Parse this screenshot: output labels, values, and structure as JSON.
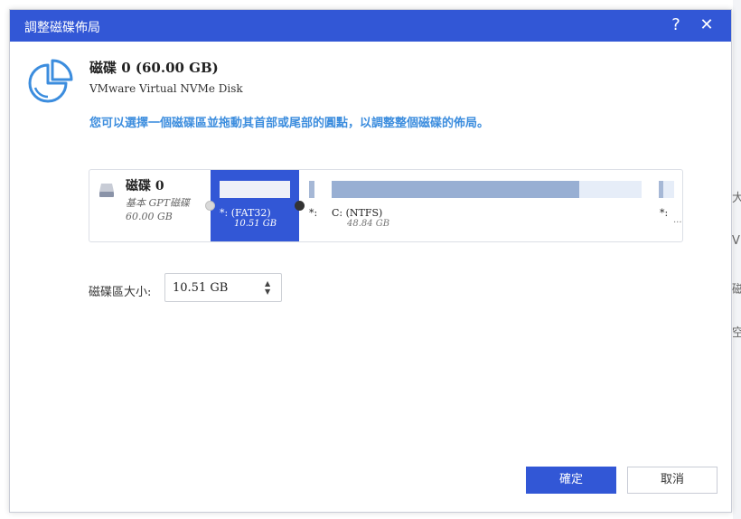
{
  "dialog": {
    "title": "調整磁碟佈局",
    "help_icon": "?",
    "close_icon": "✕"
  },
  "disk": {
    "name": "磁碟 0 (60.00 GB)",
    "model": "VMware Virtual NVMe Disk"
  },
  "instruction": "您可以選擇一個磁碟區並拖動其首部或尾部的圓點，以調整整個磁碟的佈局。",
  "layout": {
    "disk_label": "磁碟 0",
    "disk_type": "基本 GPT磁碟",
    "disk_size": "60.00 GB",
    "partitions": [
      {
        "name": "*: (FAT32)",
        "size": "10.51 GB",
        "selected": true
      },
      {
        "name": "*:",
        "size": ""
      },
      {
        "name": "C: (NTFS)",
        "size": "48.84 GB",
        "used_fraction": 0.8
      },
      {
        "name": "*:",
        "size": "..."
      }
    ]
  },
  "size_field": {
    "label": "磁碟區大小:",
    "value": "10.51 GB",
    "spin_up": "▲",
    "spin_down": "▼"
  },
  "buttons": {
    "ok": "確定",
    "cancel": "取消"
  },
  "background_fragments": [
    "大",
    "V",
    "磁",
    "空"
  ],
  "colors": {
    "accent": "#3257d6",
    "instruction": "#3c8dde"
  }
}
